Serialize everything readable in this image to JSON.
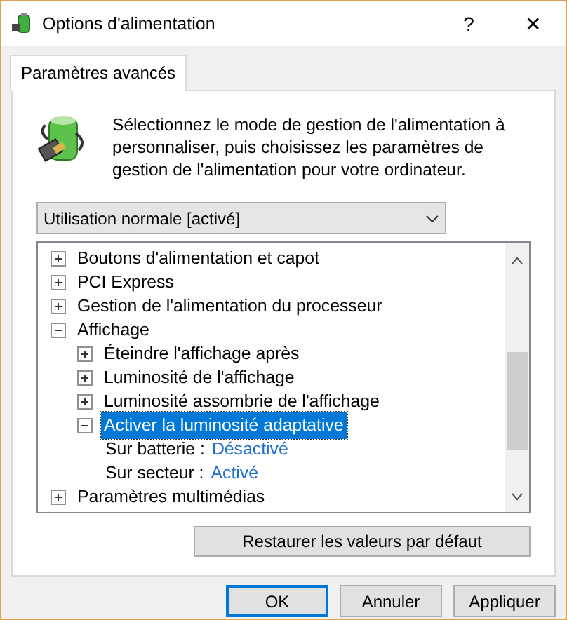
{
  "window": {
    "title": "Options d'alimentation",
    "help": "?",
    "close": "✕"
  },
  "tabs": [
    {
      "label": "Paramètres avancés",
      "selected": true
    }
  ],
  "description": "Sélectionnez le mode de gestion de l'alimentation à personnaliser, puis choisissez les paramètres de gestion de l'alimentation pour votre ordinateur.",
  "plan_select": {
    "value": "Utilisation normale [activé]"
  },
  "tree": [
    {
      "kind": "group",
      "label": "Boutons d'alimentation et capot",
      "expanded": false,
      "selected": false
    },
    {
      "kind": "group",
      "label": "PCI Express",
      "expanded": false,
      "selected": false
    },
    {
      "kind": "group",
      "label": "Gestion de l'alimentation du processeur",
      "expanded": false,
      "selected": false
    },
    {
      "kind": "group",
      "label": "Affichage",
      "expanded": true,
      "selected": false,
      "children": [
        {
          "kind": "group",
          "label": "Éteindre l'affichage après",
          "expanded": false,
          "selected": false
        },
        {
          "kind": "group",
          "label": "Luminosité de l'affichage",
          "expanded": false,
          "selected": false
        },
        {
          "kind": "group",
          "label": "Luminosité assombrie de l'affichage",
          "expanded": false,
          "selected": false
        },
        {
          "kind": "group",
          "label": "Activer la luminosité adaptative",
          "expanded": true,
          "selected": true,
          "children": [
            {
              "kind": "setting",
              "label": "Sur batterie :",
              "value": "Désactivé"
            },
            {
              "kind": "setting",
              "label": "Sur secteur :",
              "value": "Activé"
            }
          ]
        }
      ]
    },
    {
      "kind": "group",
      "label": "Paramètres multimédias",
      "expanded": false,
      "selected": false
    }
  ],
  "restore_button": "Restaurer les valeurs par défaut",
  "buttons": [
    {
      "label": "OK",
      "default": true
    },
    {
      "label": "Annuler",
      "default": false
    },
    {
      "label": "Appliquer",
      "default": false
    }
  ]
}
